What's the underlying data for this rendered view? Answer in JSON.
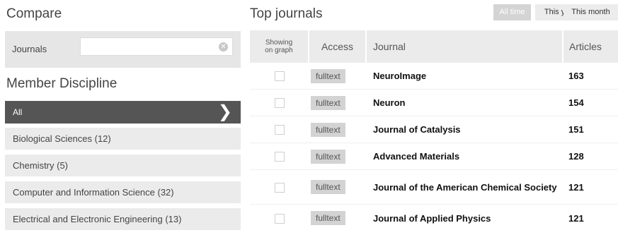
{
  "compare": {
    "title": "Compare",
    "journals_label": "Journals",
    "input_value": "",
    "clear_glyph": "✕"
  },
  "discipline": {
    "title": "Member Discipline",
    "chevron_glyph": "❯",
    "items": [
      {
        "label": "All",
        "active": true
      },
      {
        "label": "Biological Sciences (12)",
        "active": false
      },
      {
        "label": "Chemistry (5)",
        "active": false
      },
      {
        "label": "Computer and Information Science (32)",
        "active": false
      },
      {
        "label": "Electrical and Electronic Engineering (13)",
        "active": false
      }
    ]
  },
  "top_journals": {
    "title": "Top journals",
    "ranges": [
      {
        "label": "All time",
        "active": true
      },
      {
        "label": "This year",
        "active": false
      },
      {
        "label": "This month",
        "active": false
      }
    ],
    "columns": {
      "showing_line1": "Showing",
      "showing_line2": "on graph",
      "access": "Access",
      "journal": "Journal",
      "articles": "Articles"
    },
    "rows": [
      {
        "access": "fulltext",
        "journal": "NeuroImage",
        "articles": "163",
        "checked": false
      },
      {
        "access": "fulltext",
        "journal": "Neuron",
        "articles": "154",
        "checked": false
      },
      {
        "access": "fulltext",
        "journal": "Journal of Catalysis",
        "articles": "151",
        "checked": false
      },
      {
        "access": "fulltext",
        "journal": "Advanced Materials",
        "articles": "128",
        "checked": false
      },
      {
        "access": "fulltext",
        "journal": "Journal of the American Chemical Society",
        "articles": "121",
        "checked": false
      },
      {
        "access": "fulltext",
        "journal": "Journal of Applied Physics",
        "articles": "121",
        "checked": false
      }
    ]
  }
}
